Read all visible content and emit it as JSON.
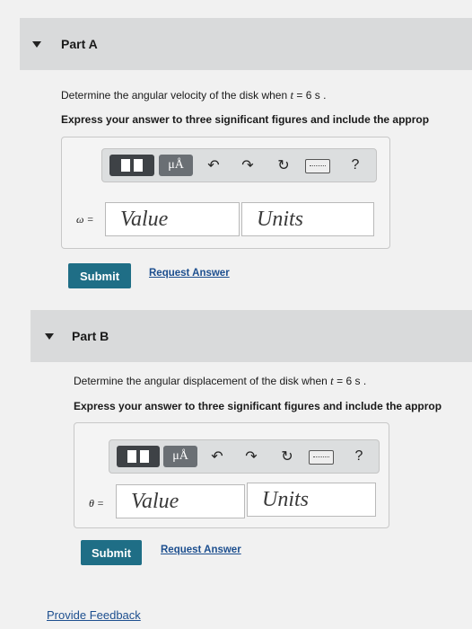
{
  "partA": {
    "title": "Part A",
    "question_prefix": "Determine the angular velocity of the disk when ",
    "question_var": "t",
    "question_suffix": " = 6 s .",
    "instruction": "Express your answer to three significant figures and include the approp",
    "variable_label": "ω =",
    "value_placeholder": "Value",
    "units_placeholder": "Units",
    "submit_label": "Submit",
    "request_label": "Request Answer",
    "mu_label": "μÅ",
    "help_label": "?"
  },
  "partB": {
    "title": "Part B",
    "question_prefix": "Determine the angular displacement of the disk when ",
    "question_var": "t",
    "question_suffix": " = 6 s .",
    "instruction": "Express your answer to three significant figures and include the approp",
    "variable_label": "θ =",
    "value_placeholder": "Value",
    "units_placeholder": "Units",
    "submit_label": "Submit",
    "request_label": "Request Answer",
    "mu_label": "μÅ",
    "help_label": "?"
  },
  "feedback_label": "Provide Feedback",
  "colors": {
    "submit_bg": "#1f6e86",
    "link": "#1d4f8f",
    "header_bg": "#d9dadb"
  },
  "icons": [
    "caret-down-icon",
    "template-icon",
    "mu-angstrom-icon",
    "undo-icon",
    "redo-icon",
    "reset-icon",
    "keyboard-icon",
    "help-icon"
  ]
}
